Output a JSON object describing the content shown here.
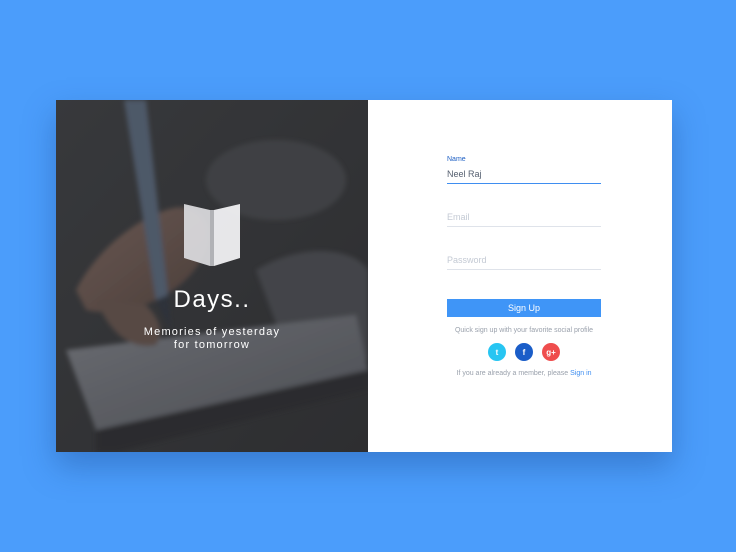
{
  "brand": {
    "title": "Days..",
    "tagline_line1": "Memories of yesterday",
    "tagline_line2": "for tomorrow"
  },
  "form": {
    "name_label": "Name",
    "name_value": "Neel Raj",
    "email_placeholder": "Email",
    "password_placeholder": "Password",
    "signup_label": "Sign Up",
    "social_hint": "Quick sign up with your favorite social profile",
    "member_text": "If you are already a member, please",
    "signin_label": "Sign in"
  },
  "social": {
    "twitter": "t",
    "facebook": "f",
    "google": "g+"
  },
  "colors": {
    "background": "#4b9dfb",
    "accent": "#3f95f7",
    "twitter": "#27c5f2",
    "facebook": "#1a5dc8",
    "google": "#ef4d4d"
  }
}
